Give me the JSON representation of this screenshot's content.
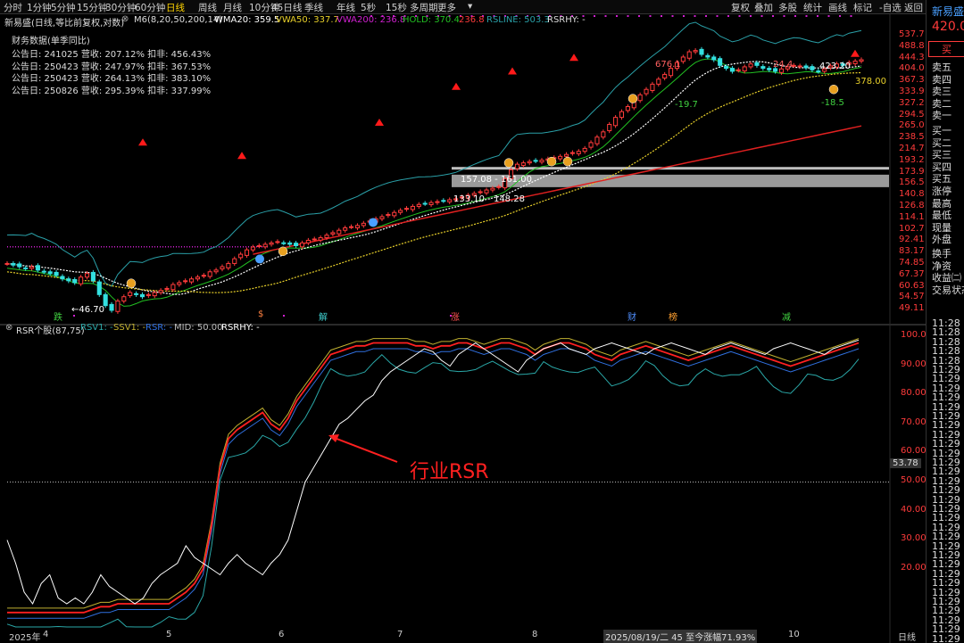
{
  "toolbar": {
    "timeframes": [
      "分时",
      "1分钟",
      "5分钟",
      "15分钟",
      "30分钟",
      "60分钟",
      "日线",
      "周线",
      "月线",
      "10分钟",
      "45日线",
      "季线",
      "年线",
      "5秒",
      "15秒",
      "多周期",
      "更多"
    ],
    "active": "日线",
    "right": [
      "复权",
      "叠加",
      "多股",
      "统计",
      "画线",
      "标记",
      "-自选",
      "返回"
    ]
  },
  "main": {
    "stock_label": "新易盛(日线,等比前复权,对数)",
    "m6_label": "M6(8,20,50,200,14)",
    "wma20": "WMA20: 359.5",
    "vwa50": "VWA50: 337.7",
    "vwa200": "VWA200: 236.8",
    "hold": "HOLD: 370.4",
    "hold_red": "236.8",
    "rsline": "RSLINE: 503.3",
    "rsrhy": "RSRHY: -",
    "fin_title": "财务数据(单季同比)",
    "fin_rows": [
      "公告日: 241025   营收: 207.12%   扣非: 456.43%",
      "公告日: 250423   营收: 247.97%   扣非: 367.53%",
      "公告日: 250423   营收: 264.13%   扣非: 383.10%",
      "公告日: 250826   营收: 295.39%   扣非: 337.99%"
    ],
    "annotations": {
      "low": "46.70",
      "high": "676.1",
      "p24": "24.4",
      "p197": "-19.7",
      "p423": "423.20",
      "p37x": "378.00",
      "p185": "-18.5",
      "zone1": "157.08 - 161.00",
      "zone2": "133.10 - 148.28"
    },
    "markers": [
      "跌",
      "$",
      "解",
      "涨",
      "财",
      "榜",
      "减"
    ],
    "price_axis": [
      "537.7",
      "488.8",
      "444.3",
      "404.0",
      "367.3",
      "333.9",
      "327.2",
      "294.5",
      "265.0",
      "238.5",
      "214.7",
      "193.2",
      "173.9",
      "156.5",
      "140.8",
      "126.8",
      "114.1",
      "102.7",
      "92.41",
      "83.17",
      "74.85",
      "67.37",
      "60.63",
      "54.57",
      "49.11"
    ]
  },
  "rsr": {
    "label": "RSR个股(87,75)",
    "rsv1": "RSV1: -",
    "ssv1": "SSV1: -",
    "rsr": "RSR: -",
    "mid": "MID: 50.00",
    "rsrhy": "RSRHY: -",
    "axis": [
      "100.0",
      "90.00",
      "80.00",
      "70.00",
      "60.00",
      "50.00",
      "40.00",
      "30.00",
      "20.00"
    ],
    "current": "53.78",
    "annotation": "行业RSR"
  },
  "xaxis": {
    "year": "2025年",
    "months": [
      "4",
      "5",
      "6",
      "7",
      "8",
      "10"
    ],
    "info": "2025/08/19/二 45 至今涨幅71.93%",
    "period": "日线"
  },
  "side": {
    "name": "新易盛",
    "price": "420.0",
    "buy": "买",
    "labels": [
      "卖五",
      "卖四",
      "卖三",
      "卖二",
      "卖一",
      "买一",
      "买二",
      "买三",
      "买四",
      "买五",
      "涨停",
      "最高",
      "最低",
      "现量",
      "外盘",
      "换手",
      "净资",
      "收益㈡",
      "交易状态"
    ],
    "times": [
      "11:28",
      "11:28",
      "11:28",
      "11:28",
      "11:28",
      "11:29",
      "11:29",
      "11:29",
      "11:29",
      "11:29",
      "11:29",
      "11:29",
      "11:29",
      "11:29",
      "11:29",
      "11:29",
      "11:29",
      "11:29",
      "11:29",
      "11:29",
      "11:29",
      "11:29",
      "11:29",
      "11:29",
      "11:29",
      "11:29",
      "11:29",
      "11:29",
      "11:29",
      "11:29",
      "11:29",
      "11:29",
      "11:29",
      "11:29",
      "11:29",
      "11:29"
    ]
  },
  "colors": {
    "up": "#ff3b3b",
    "down": "#33e0e0",
    "wma20": "#ffffff",
    "vwa50": "#e8d02a",
    "vwa200": "#e02020",
    "hold": "#22c022",
    "rsline": "#2aa0a8",
    "magenta": "#d020d0"
  },
  "chart_data": [
    {
      "type": "candlestick",
      "title": "新易盛(日线,等比前复权,对数)",
      "yscale": "log",
      "ylim": [
        49.11,
        537.7
      ],
      "x_months": [
        "4",
        "5",
        "6",
        "7",
        "8",
        "10"
      ],
      "close": [
        72,
        71,
        70,
        69,
        70,
        68,
        67,
        66,
        65,
        63,
        62,
        61,
        64,
        66,
        62,
        55,
        50,
        48,
        52,
        54,
        56,
        55,
        54,
        55,
        56,
        57,
        58,
        60,
        61,
        62,
        63,
        64,
        65,
        67,
        68,
        70,
        72,
        75,
        78,
        81,
        83,
        84,
        85,
        86,
        87,
        86,
        85,
        84,
        86,
        88,
        89,
        90,
        92,
        94,
        96,
        98,
        99,
        100,
        102,
        104,
        106,
        108,
        110,
        112,
        114,
        116,
        118,
        120,
        121,
        122,
        123,
        124,
        125,
        126,
        128,
        130,
        132,
        134,
        136,
        138,
        140,
        150,
        162,
        170,
        172,
        174,
        175,
        176,
        178,
        180,
        182,
        185,
        188,
        190,
        195,
        205,
        215,
        225,
        240,
        255,
        268,
        280,
        295,
        310,
        325,
        340,
        355,
        370,
        390,
        410,
        430,
        450,
        455,
        440,
        430,
        420,
        400,
        390,
        380,
        385,
        395,
        405,
        400,
        390,
        385,
        380,
        388,
        395,
        400,
        398,
        392,
        385,
        380,
        388,
        398,
        405,
        400,
        410,
        415,
        420
      ]
    },
    {
      "type": "line",
      "title": "RSR个股(87,75)",
      "ylim": [
        0,
        100
      ],
      "mid": 50,
      "current": 53.78,
      "series": [
        {
          "name": "RSR",
          "values": [
            5,
            5,
            5,
            5,
            5,
            5,
            5,
            5,
            5,
            5,
            6,
            7,
            7,
            8,
            8,
            8,
            8,
            8,
            8,
            8,
            10,
            12,
            15,
            20,
            35,
            55,
            65,
            68,
            70,
            72,
            74,
            70,
            68,
            72,
            78,
            82,
            86,
            90,
            94,
            95,
            96,
            97,
            97,
            98,
            98,
            98,
            98,
            98,
            97,
            97,
            96,
            97,
            97,
            98,
            98,
            97,
            96,
            97,
            98,
            98,
            97,
            96,
            94,
            96,
            97,
            98,
            98,
            97,
            96,
            94,
            93,
            92,
            94,
            95,
            96,
            97,
            96,
            95,
            94,
            93,
            92,
            93,
            94,
            95,
            96,
            97,
            96,
            95,
            94,
            93,
            92,
            91,
            90,
            91,
            92,
            93,
            94,
            95,
            96,
            97,
            98
          ]
        },
        {
          "name": "RSRHY",
          "values": [
            30,
            22,
            12,
            8,
            15,
            18,
            10,
            8,
            10,
            8,
            12,
            18,
            14,
            12,
            10,
            8,
            10,
            15,
            18,
            20,
            22,
            28,
            24,
            22,
            20,
            18,
            22,
            25,
            22,
            20,
            18,
            22,
            25,
            30,
            40,
            50,
            55,
            60,
            65,
            70,
            72,
            75,
            78,
            80,
            85,
            88,
            90,
            92,
            94,
            96,
            95,
            92,
            90,
            94,
            96,
            98,
            96,
            94,
            92,
            90,
            88,
            92,
            94,
            96,
            97,
            98,
            96,
            95,
            94,
            96,
            97,
            98,
            97,
            96,
            95,
            94,
            96,
            97,
            98,
            97,
            96,
            95,
            94,
            96,
            97,
            98,
            97,
            96,
            95,
            94,
            96,
            97,
            98,
            97,
            96,
            95,
            94,
            96,
            97,
            98,
            99
          ]
        }
      ]
    }
  ]
}
